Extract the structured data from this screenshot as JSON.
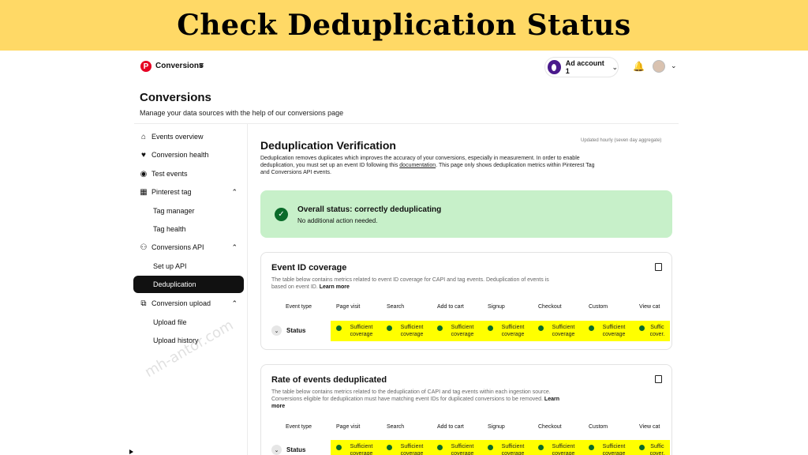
{
  "banner": {
    "title": "Check Deduplication Status"
  },
  "topbar": {
    "logo_glyph": "P",
    "brand": "Conversions",
    "menu_glyph": "≡",
    "account": "Ad account 1",
    "chevron": "⌄",
    "bell_glyph": "🔔"
  },
  "page": {
    "title": "Conversions",
    "subtitle": "Manage your data sources with the help of our conversions page"
  },
  "sidebar": {
    "items": [
      {
        "label": "Events overview",
        "icon": "home-icon",
        "glyph": "⌂"
      },
      {
        "label": "Conversion health",
        "icon": "heart-pulse-icon",
        "glyph": "♥"
      },
      {
        "label": "Test events",
        "icon": "chat-icon",
        "glyph": "◉"
      },
      {
        "label": "Pinterest tag",
        "icon": "tag-icon",
        "glyph": "▦",
        "caret": "⌃"
      },
      {
        "label": "Tag manager"
      },
      {
        "label": "Tag health"
      },
      {
        "label": "Conversions API",
        "icon": "api-icon",
        "glyph": "⚇",
        "caret": "⌃"
      },
      {
        "label": "Set up API"
      },
      {
        "label": "Deduplication",
        "active": true
      },
      {
        "label": "Conversion upload",
        "icon": "upload-icon",
        "glyph": "⧉",
        "caret": "⌃"
      },
      {
        "label": "Upload file"
      },
      {
        "label": "Upload history"
      }
    ]
  },
  "main": {
    "title": "Deduplication Verification",
    "updated": "Updated hourly (seven day aggregate)",
    "desc_part1": "Deduplication removes duplicates which improves the accuracy of your conversions, especially in measurement. In order to enable deduplication, you must set up an event ID following this ",
    "desc_link": "documentation",
    "desc_part2": ". This page only shows deduplication metrics within Pinterest Tag and Conversions API events.",
    "overall": {
      "title": "Overall status: correctly deduplicating",
      "subtitle": "No additional action needed.",
      "check_glyph": "✓",
      "color": "#c7f0c9"
    }
  },
  "cards": [
    {
      "title": "Event ID coverage",
      "desc": "The table below contains metrics related to event ID coverage for CAPI and tag events. Deduplication of events is based on event ID.",
      "learn_more": "Learn more",
      "headers": [
        "Event type",
        "Page visit",
        "Search",
        "Add to cart",
        "Signup",
        "Checkout",
        "Custom",
        "View cat"
      ],
      "row_label": "Status",
      "cells": [
        "Sufficient coverage",
        "Sufficient coverage",
        "Sufficient coverage",
        "Sufficient coverage",
        "Sufficient coverage",
        "Sufficient coverage",
        "Suffic cover."
      ]
    },
    {
      "title": "Rate of events deduplicated",
      "desc": "The table below contains metrics related to the deduplication of CAPI and tag events within each ingestion source. Conversions eligible for deduplication must have matching event IDs for duplicated conversions to be removed.",
      "learn_more": "Learn more",
      "headers": [
        "Event type",
        "Page visit",
        "Search",
        "Add to cart",
        "Signup",
        "Checkout",
        "Custom",
        "View cat"
      ],
      "row_label": "Status",
      "cells": [
        "Sufficient coverage",
        "Sufficient coverage",
        "Sufficient coverage",
        "Sufficient coverage",
        "Sufficient coverage",
        "Sufficient coverage",
        "Suffic cover."
      ]
    }
  ],
  "watermark": "mh-antor.com",
  "colors": {
    "banner": "#ffd966",
    "highlight": "#ffff00",
    "success": "#0a6b2a",
    "brand": "#e60023"
  }
}
